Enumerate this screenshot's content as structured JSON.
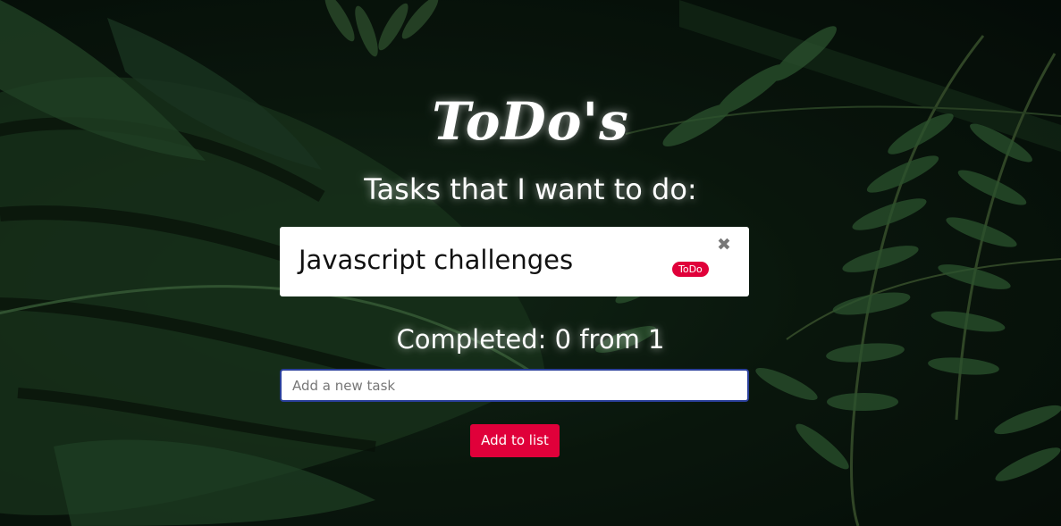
{
  "app": {
    "title": "ToDo's",
    "subtitle": "Tasks that I want to do:"
  },
  "tasks": [
    {
      "text": "Javascript challenges",
      "status": "ToDo",
      "remove_icon": "close-icon",
      "remove_glyph": "✖"
    }
  ],
  "summary": {
    "completed_text": "Completed: 0 from 1",
    "completed_count": 0,
    "total_count": 1
  },
  "form": {
    "input_value": "",
    "input_placeholder": "Add a new task",
    "add_button_label": "Add to list"
  },
  "colors": {
    "accent": "#e0003a",
    "input_focus_border": "#2a3f9a",
    "text_on_dark": "#ffffff",
    "background_dark": "#0d1e11"
  },
  "background": {
    "description_icon": "tropical-leaves-background"
  }
}
